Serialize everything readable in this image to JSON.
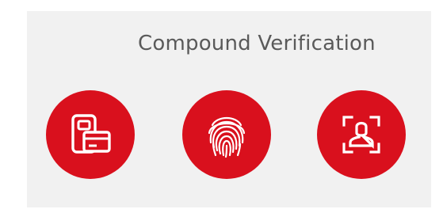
{
  "panel": {
    "title": "Compound Verification"
  },
  "methods": [
    {
      "name": "card-icon",
      "kind": "phone-and-card"
    },
    {
      "name": "fingerprint-icon",
      "kind": "fingerprint"
    },
    {
      "name": "face-scan-icon",
      "kind": "face-recognition"
    }
  ],
  "colors": {
    "accent": "#d9101d",
    "panel_bg": "#f1f1f1",
    "title_text": "#5a5a5a",
    "icon_stroke": "#ffffff"
  }
}
